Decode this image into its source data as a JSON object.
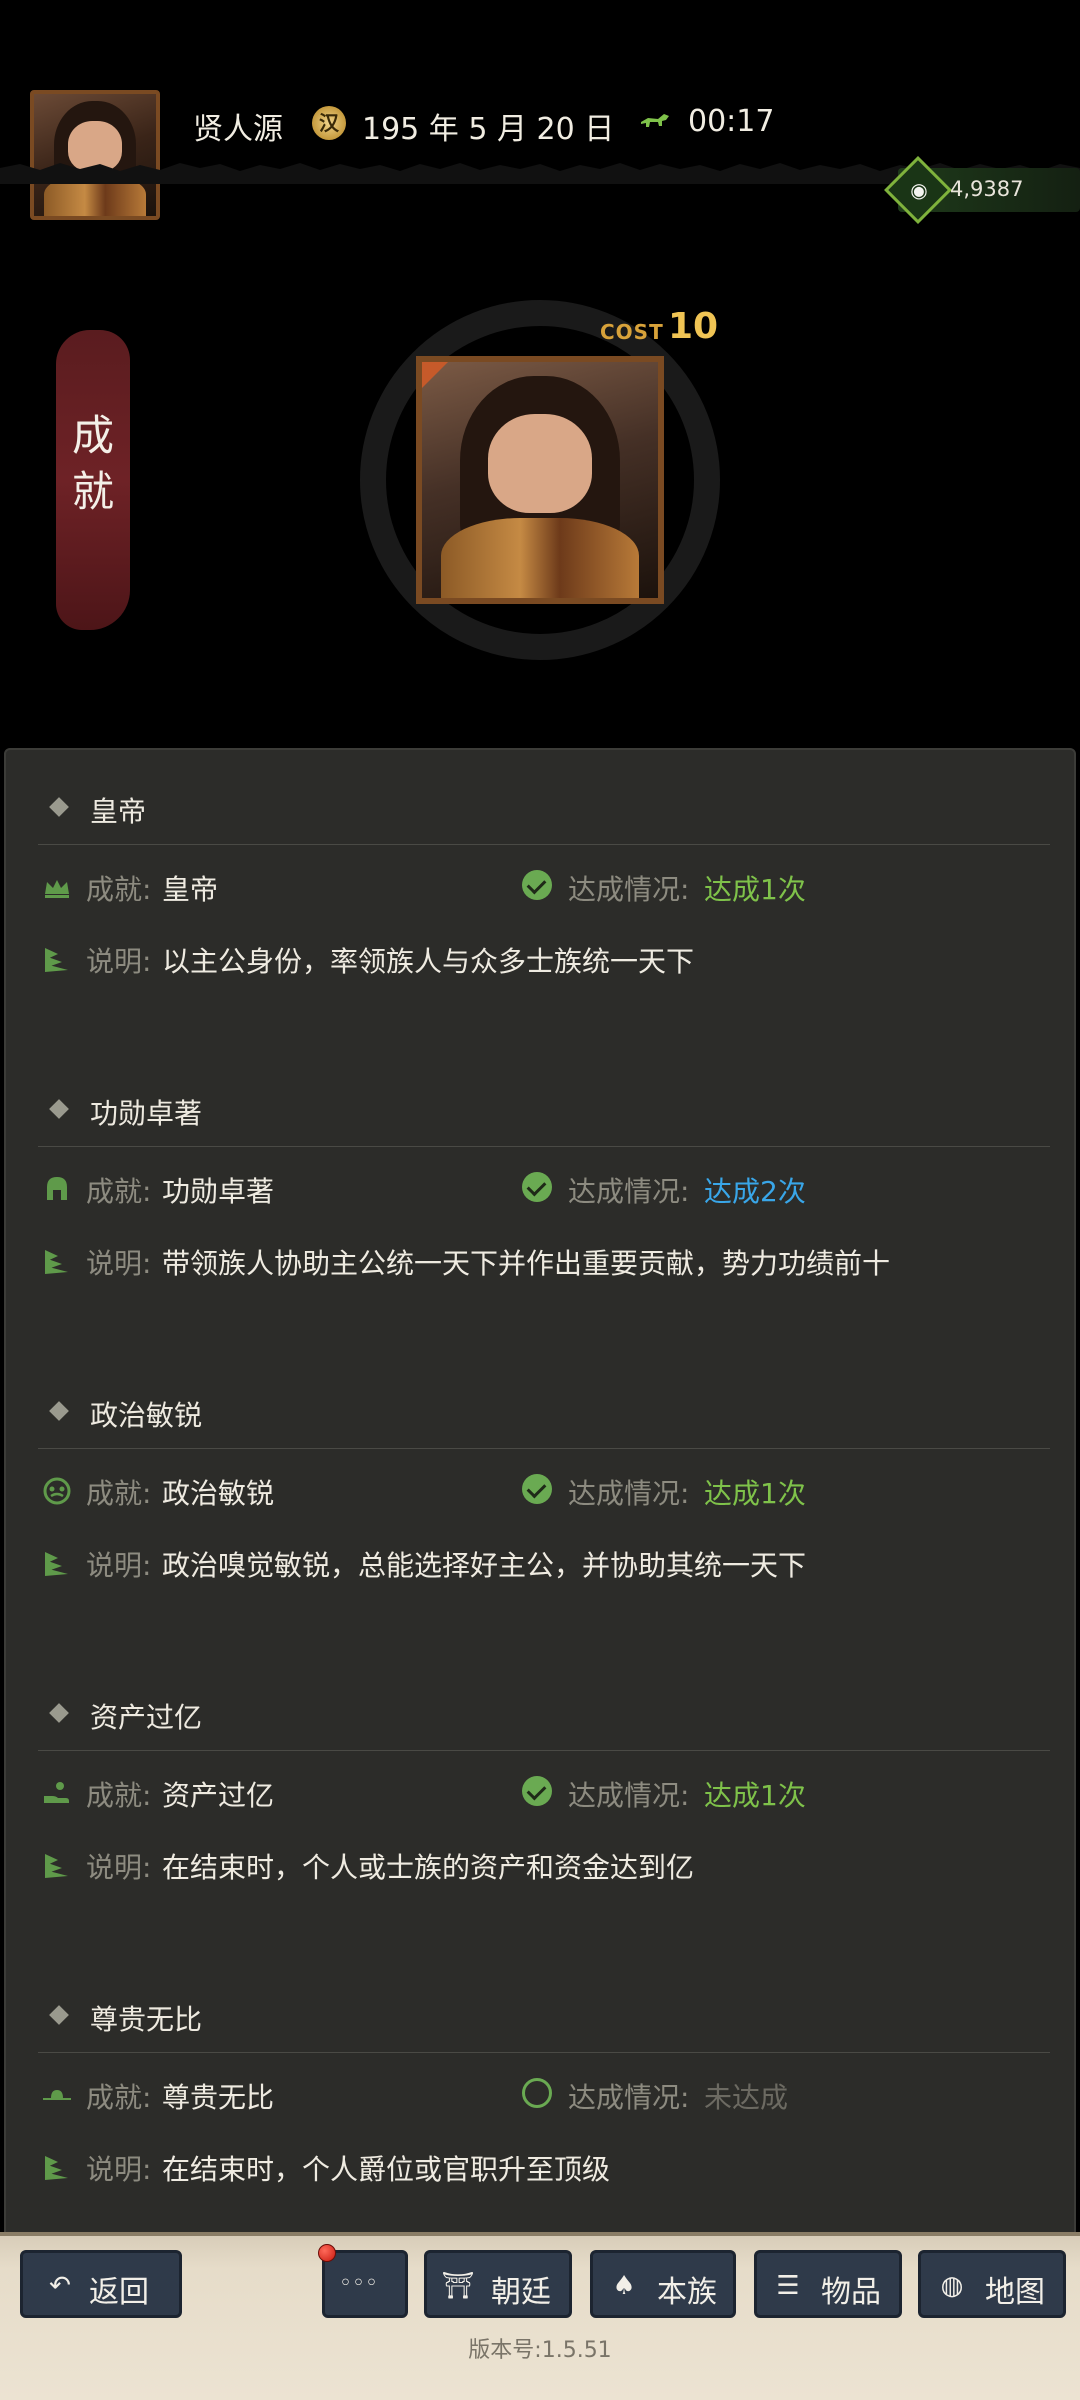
{
  "header": {
    "player_name": "贤人源",
    "year_glyph": "汉",
    "date": "195 年 5 月 20 日",
    "time": "00:17",
    "money": "4,9387"
  },
  "profile": {
    "banner_title": "成就",
    "cost_label": "COST",
    "cost_value": "10"
  },
  "achievements": [
    {
      "title": "皇帝",
      "icon": "crown-icon",
      "label_achievement": "成就:",
      "name": "皇帝",
      "label_status": "达成情况:",
      "status": "达成1次",
      "status_color": "#7fc24a",
      "completed": true,
      "label_desc": "说明:",
      "description": "以主公身份，率领族人与众多士族统一天下"
    },
    {
      "title": "功勋卓著",
      "icon": "helmet-icon",
      "label_achievement": "成就:",
      "name": "功勋卓著",
      "label_status": "达成情况:",
      "status": "达成2次",
      "status_color": "#39a6e8",
      "completed": true,
      "label_desc": "说明:",
      "description": "带领族人协助主公统一天下并作出重要贡献，势力功绩前十"
    },
    {
      "title": "政治敏锐",
      "icon": "mask-icon",
      "label_achievement": "成就:",
      "name": "政治敏锐",
      "label_status": "达成情况:",
      "status": "达成1次",
      "status_color": "#7fc24a",
      "completed": true,
      "label_desc": "说明:",
      "description": "政治嗅觉敏锐，总能选择好主公，并协助其统一天下"
    },
    {
      "title": "资产过亿",
      "icon": "hand-coin-icon",
      "label_achievement": "成就:",
      "name": "资产过亿",
      "label_status": "达成情况:",
      "status": "达成1次",
      "status_color": "#7fc24a",
      "completed": true,
      "label_desc": "说明:",
      "description": "在结束时，个人或士族的资产和资金达到亿"
    },
    {
      "title": "尊贵无比",
      "icon": "official-hat-icon",
      "label_achievement": "成就:",
      "name": "尊贵无比",
      "label_status": "达成情况:",
      "status": "未达成",
      "status_color": "#6c6a62",
      "completed": false,
      "label_desc": "说明:",
      "description": "在结束时，个人爵位或官职升至顶级"
    }
  ],
  "nav": {
    "back": "返回",
    "more": "◦◦◦",
    "court": "朝廷",
    "clan": "本族",
    "items": "物品",
    "map": "地图"
  },
  "version": "版本号:1.5.51"
}
